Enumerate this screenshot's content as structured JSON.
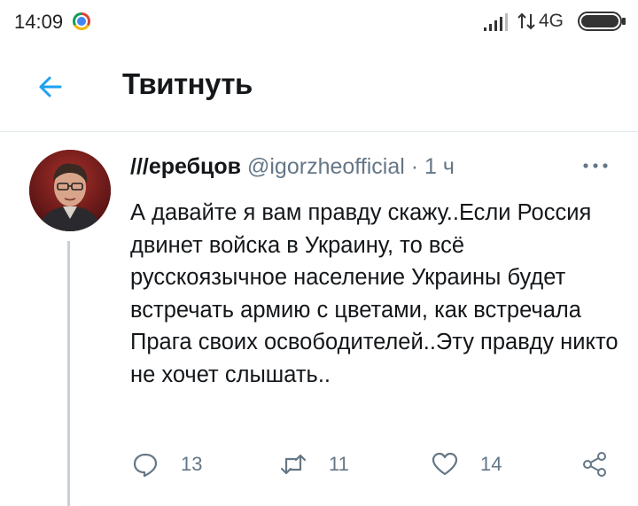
{
  "status_bar": {
    "time": "14:09",
    "network": "4G"
  },
  "header": {
    "title": "Твитнуть"
  },
  "tweet": {
    "author_name": "///еребцов",
    "author_handle": "@igorzheofficial",
    "separator": "·",
    "time": "1 ч",
    "text": "А давайте я вам правду скажу..Если Россия двинет войска в Украину, то всё русскоязычное население Украины будет встречать армию с цветами, как встречала Прага своих освободителей..Эту правду никто не хочет слышать..",
    "reply_count": "13",
    "retweet_count": "11",
    "like_count": "14"
  },
  "colors": {
    "accent": "#1da1f2",
    "secondary_text": "#657786",
    "divider": "#e1e8ed"
  }
}
